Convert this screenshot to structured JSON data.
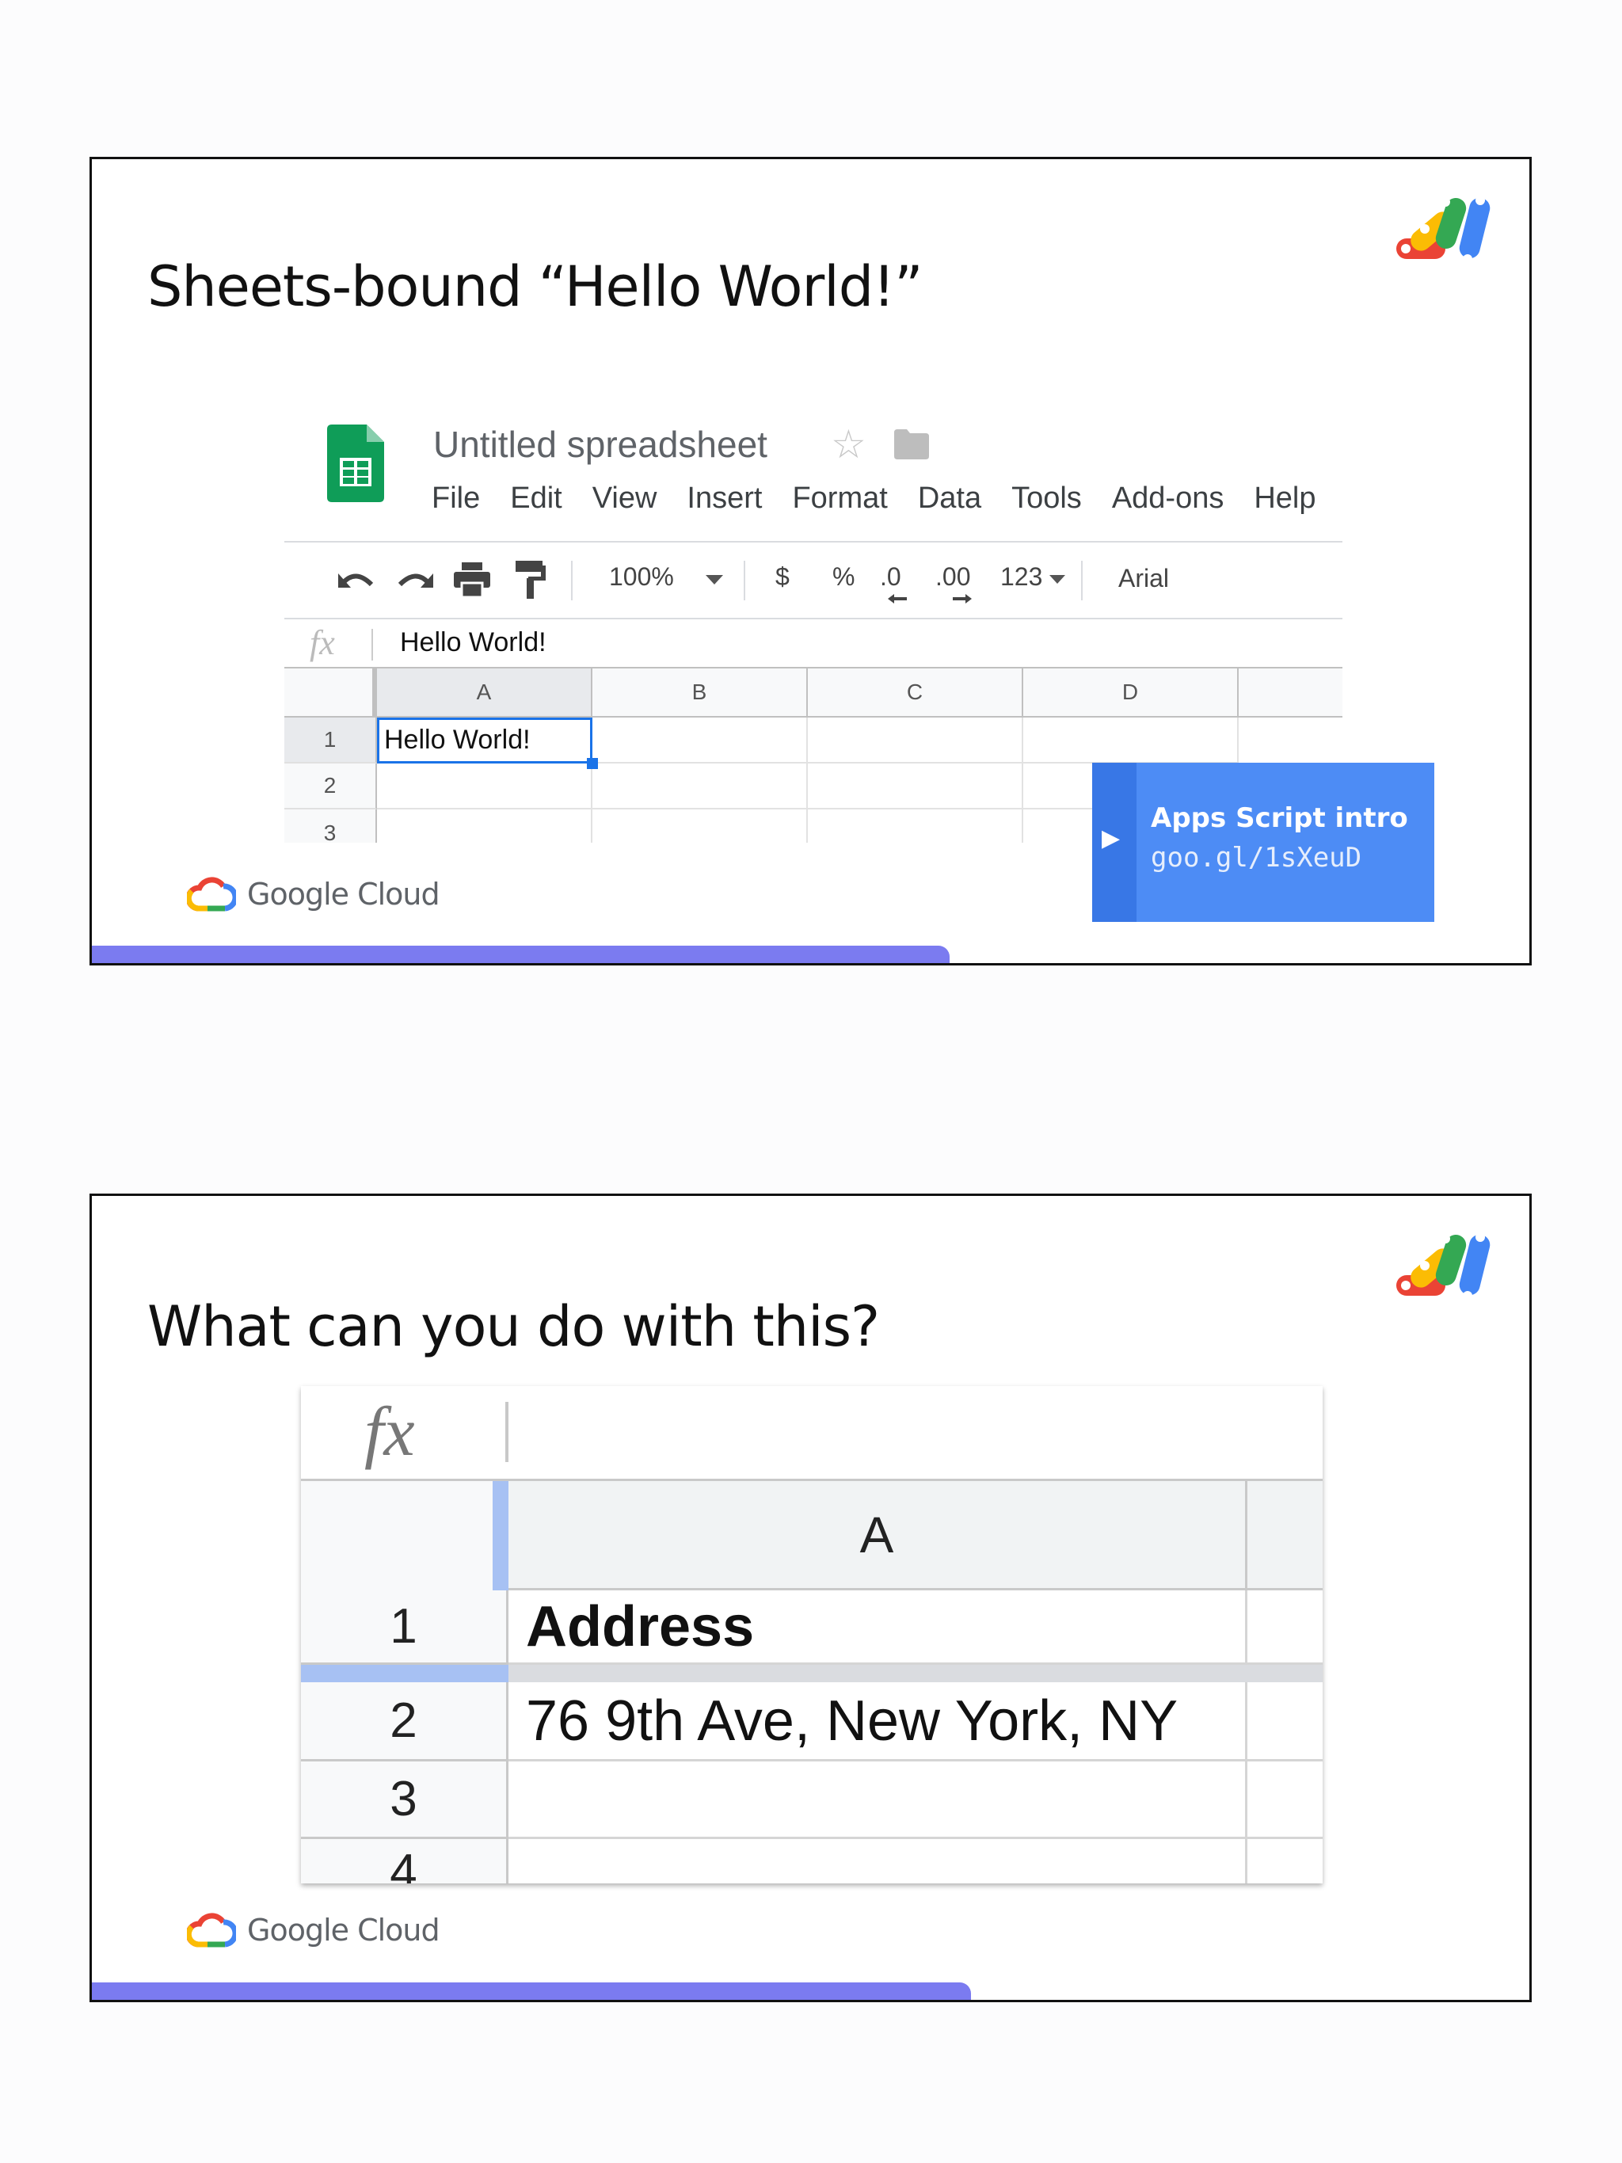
{
  "slide1": {
    "title": "Sheets-bound “Hello World!”",
    "spreadsheet": {
      "doc_title": "Untitled spreadsheet",
      "menu": [
        "File",
        "Edit",
        "View",
        "Insert",
        "Format",
        "Data",
        "Tools",
        "Add-ons",
        "Help"
      ],
      "toolbar": {
        "zoom": "100%",
        "currency": "$",
        "percent": "%",
        "decrease_decimal": ".0",
        "increase_decimal": ".00",
        "number_format": "123",
        "font": "Arial"
      },
      "formula_value": "Hello World!",
      "columns": [
        "A",
        "B",
        "C",
        "D"
      ],
      "rows": [
        "1",
        "2",
        "3"
      ],
      "cell_a1": "Hello World!"
    },
    "cta": {
      "title": "Apps Script intro",
      "link": "goo.gl/1sXeuD"
    },
    "footer": "Google Cloud"
  },
  "slide2": {
    "title": "What can you do with this?",
    "spreadsheet": {
      "column": "A",
      "rows": [
        {
          "num": "1",
          "value": "Address"
        },
        {
          "num": "2",
          "value": "76 9th Ave, New York, NY"
        },
        {
          "num": "3",
          "value": ""
        },
        {
          "num": "4",
          "value": ""
        }
      ]
    },
    "footer": "Google Cloud"
  },
  "colors": {
    "accent_bar": "#7b7bf0",
    "cta_bg": "#4d8cf5",
    "sheets_green": "#0f9d58",
    "selection_blue": "#1a73e8"
  }
}
